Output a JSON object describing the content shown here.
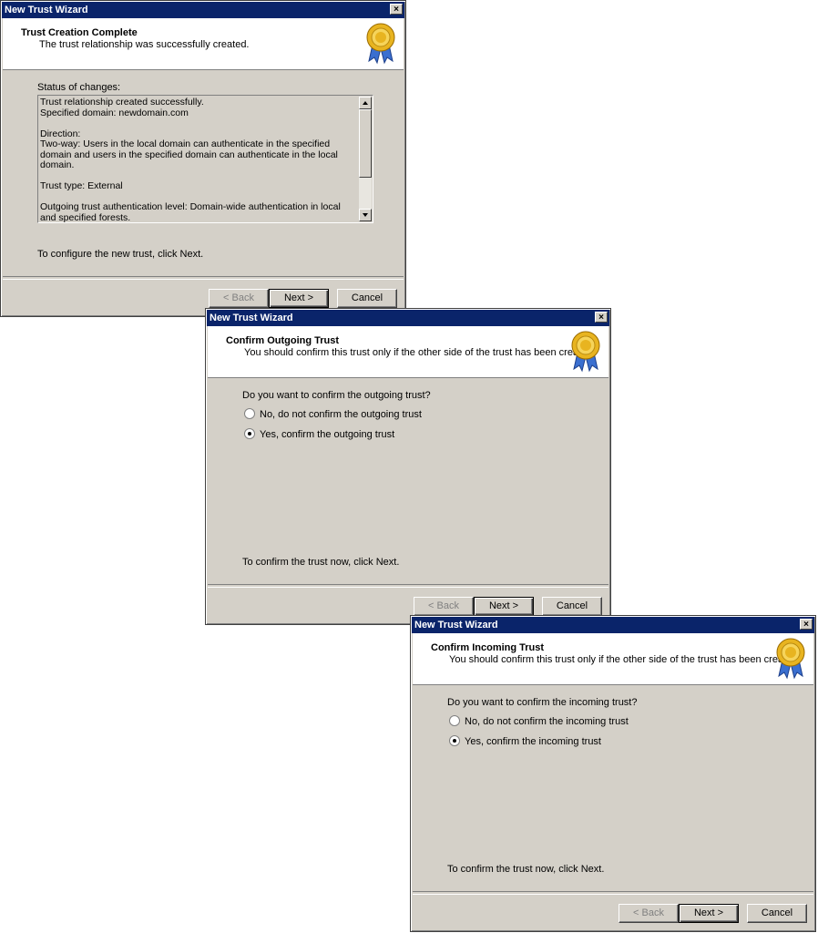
{
  "dialogs": [
    {
      "title": "New Trust Wizard",
      "header_title": "Trust Creation Complete",
      "header_subtitle": "The trust relationship was successfully created.",
      "status_label": "Status of changes:",
      "status_lines": [
        "Trust relationship created successfully.",
        "Specified domain: newdomain.com",
        "Direction:",
        "Two-way: Users in the local domain can authenticate in the specified domain and users in the specified domain can authenticate in the local domain.",
        "Trust type: External",
        "Outgoing trust authentication level: Domain-wide authentication in local and specified forests."
      ],
      "footer_note": "To configure the new trust, click Next.",
      "buttons": {
        "back": "< Back",
        "next": "Next >",
        "cancel": "Cancel"
      },
      "close": "×"
    },
    {
      "title": "New Trust Wizard",
      "header_title": "Confirm Outgoing Trust",
      "header_subtitle": "You should confirm this trust only if the other side of the trust has been created.",
      "question": "Do you want to confirm the outgoing trust?",
      "options": [
        {
          "label": "No, do not confirm the outgoing trust",
          "checked": false
        },
        {
          "label": "Yes, confirm the outgoing trust",
          "checked": true
        }
      ],
      "footer_note": "To confirm the trust now, click Next.",
      "buttons": {
        "back": "< Back",
        "next": "Next >",
        "cancel": "Cancel"
      },
      "close": "×"
    },
    {
      "title": "New Trust Wizard",
      "header_title": "Confirm Incoming Trust",
      "header_subtitle": "You should confirm this trust only if the other side of the trust has been created.",
      "question": "Do you want to confirm the incoming trust?",
      "options": [
        {
          "label": "No, do not confirm the incoming trust",
          "checked": false
        },
        {
          "label": "Yes, confirm the incoming trust",
          "checked": true
        }
      ],
      "footer_note": "To confirm the trust now, click Next.",
      "buttons": {
        "back": "< Back",
        "next": "Next >",
        "cancel": "Cancel"
      },
      "close": "×"
    }
  ],
  "colors": {
    "titlebar": "#0a246a",
    "dialog_face": "#d4d0c8",
    "seal_gold": "#e8b420",
    "ribbon_blue": "#3a6fd0"
  },
  "icons": {
    "header_seal": "certificate-seal-icon",
    "close": "close-icon"
  }
}
